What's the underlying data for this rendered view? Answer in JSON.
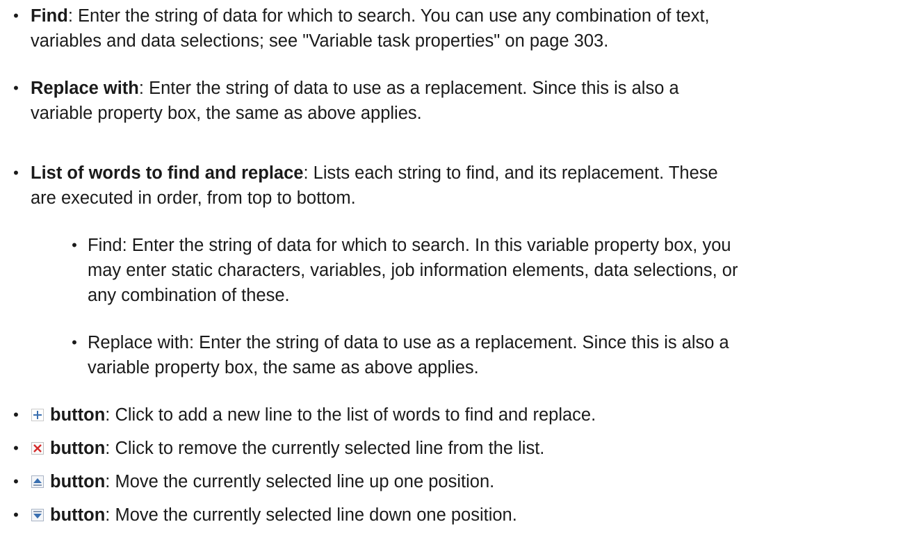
{
  "items": [
    {
      "term": "Find",
      "sep": ":",
      "desc_l1": " Enter the string of data for which to search. You can use any combination of text,",
      "desc_l2": "variables and data selections; see \"Variable task properties\" on page 303."
    },
    {
      "term": "Replace with",
      "sep": ":",
      "desc_l1": " Enter the string of data to use as a replacement. Since this is also a",
      "desc_l2": "variable property box, the same as above applies."
    },
    {
      "term": "List of words to find and replace",
      "sep": ":",
      "desc_l1": " Lists each string to find, and its replacement. These",
      "desc_l2": "are executed in order, from top to bottom."
    }
  ],
  "subitems": [
    {
      "l1": "Find: Enter the string of data for which to search. In this variable property box, you",
      "l2": "may enter static characters, variables, job information elements, data selections, or",
      "l3": "any combination of these."
    },
    {
      "l1": "Replace with: Enter the string of data to use as a replacement. Since this is also a",
      "l2": "variable property box, the same as above applies."
    }
  ],
  "buttons": [
    {
      "icon": "add-icon",
      "term": "button",
      "sep": ":",
      "desc": " Click to add a new line to the list of words to find and replace."
    },
    {
      "icon": "remove-icon",
      "term": "button",
      "sep": ":",
      "desc": " Click to remove the currently selected line from the list."
    },
    {
      "icon": "move-up-icon",
      "term": "button",
      "sep": ":",
      "desc": " Move the currently selected line up one position."
    },
    {
      "icon": "move-down-icon",
      "term": "button",
      "sep": ":",
      "desc": " Move the currently selected line down one position."
    }
  ],
  "bullet_char": "•",
  "colors": {
    "text": "#1a1a1a",
    "add_icon": "#3a6fb0",
    "remove_icon": "#d42a2a",
    "arrow_icon": "#3a6fb0"
  }
}
